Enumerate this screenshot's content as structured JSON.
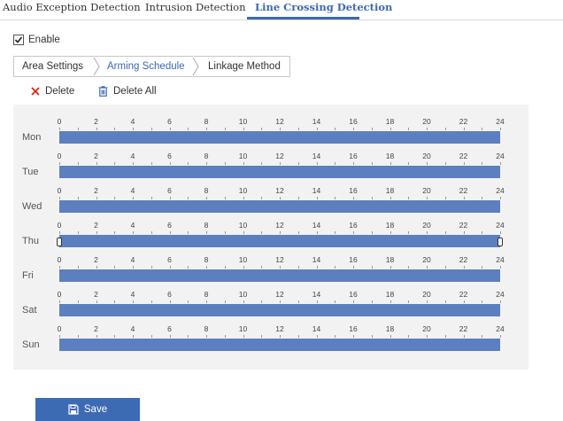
{
  "top_tabs": [
    {
      "label": "Audio Exception Detection"
    },
    {
      "label": "Intrusion Detection"
    },
    {
      "label": "Line Crossing Detection",
      "active": true
    }
  ],
  "enable": {
    "label": "Enable",
    "checked": true
  },
  "sub_tabs": [
    {
      "label": "Area Settings"
    },
    {
      "label": "Arming Schedule",
      "active": true
    },
    {
      "label": "Linkage Method"
    }
  ],
  "toolbar": {
    "delete_label": "Delete",
    "delete_all_label": "Delete All"
  },
  "schedule": {
    "hour_labels": [
      "0",
      "2",
      "4",
      "6",
      "8",
      "10",
      "12",
      "14",
      "16",
      "18",
      "20",
      "22",
      "24"
    ],
    "days": [
      {
        "label": "Mon",
        "start": 0,
        "end": 24
      },
      {
        "label": "Tue",
        "start": 0,
        "end": 24
      },
      {
        "label": "Wed",
        "start": 0,
        "end": 24
      },
      {
        "label": "Thu",
        "start": 0,
        "end": 24,
        "selected": true
      },
      {
        "label": "Fri",
        "start": 0,
        "end": 24
      },
      {
        "label": "Sat",
        "start": 0,
        "end": 24
      },
      {
        "label": "Sun",
        "start": 0,
        "end": 24
      }
    ]
  },
  "save": {
    "label": "Save"
  },
  "colors": {
    "accent": "#3d68b5",
    "bar": "#5b7fbf",
    "delete_icon": "#e0231a",
    "save_button": "#3d6bb3"
  },
  "icons": {
    "delete": "close-x-icon",
    "delete_all": "trash-icon",
    "save": "floppy-disk-icon",
    "enable": "checkbox-checked-icon"
  }
}
